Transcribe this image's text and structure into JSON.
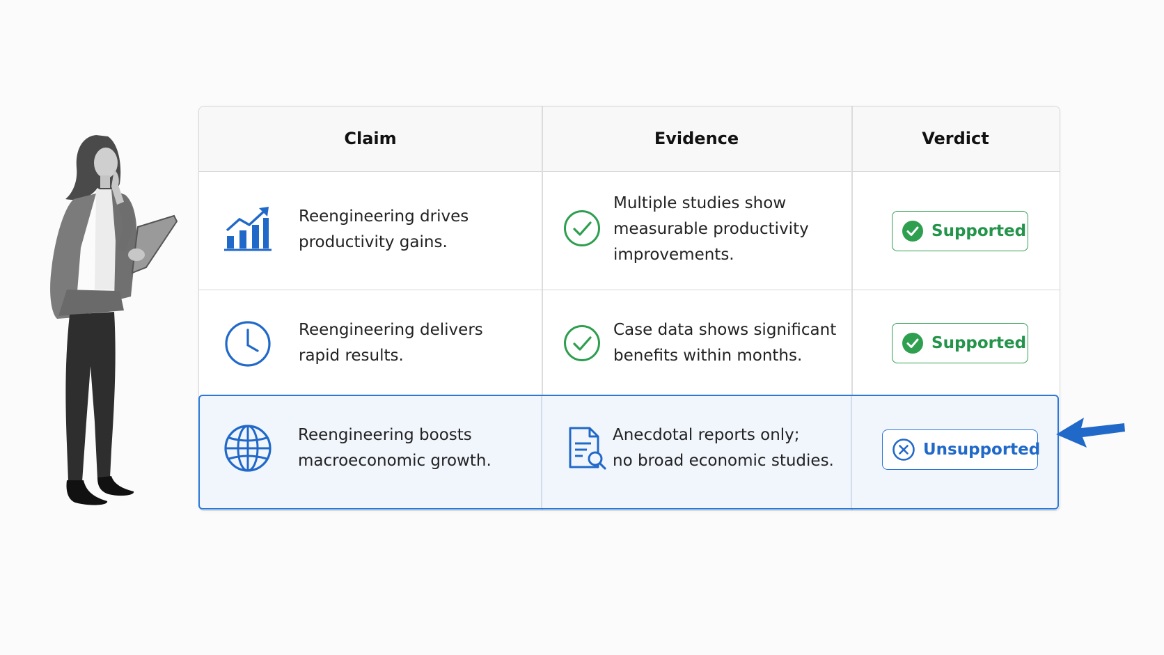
{
  "headers": {
    "claim": "Claim",
    "evidence": "Evidence",
    "verdict": "Verdict"
  },
  "rows": [
    {
      "claim_icon": "bar-chart-trend-icon",
      "claim_line1": "Reengineering drives",
      "claim_line2": "productivity gains.",
      "evidence_icon": "check-circle-icon",
      "evidence_line1": "Multiple studies show",
      "evidence_line2": "measurable productivity",
      "evidence_line3": "improvements.",
      "verdict": "Supported",
      "verdict_icon": "check-badge-icon"
    },
    {
      "claim_icon": "clock-icon",
      "claim_line1": "Reengineering delivers",
      "claim_line2": "rapid results.",
      "evidence_icon": "check-circle-icon",
      "evidence_line1": "Case data shows significant",
      "evidence_line2": "benefits within months.",
      "verdict": "Supported",
      "verdict_icon": "check-badge-icon"
    },
    {
      "claim_icon": "globe-icon",
      "claim_line1": "Reengineering boosts",
      "claim_line2": "macroeconomic growth.",
      "evidence_icon": "document-search-icon",
      "evidence_line1": "Anecdotal reports only;",
      "evidence_line2": "no broad economic studies.",
      "verdict": "Unsupported",
      "verdict_icon": "x-circle-icon",
      "highlighted": true
    }
  ],
  "colors": {
    "accent": "#2b78d8",
    "success": "#2e9e4f",
    "border": "#d6d6d6",
    "highlight_bg": "#f1f6fd"
  }
}
